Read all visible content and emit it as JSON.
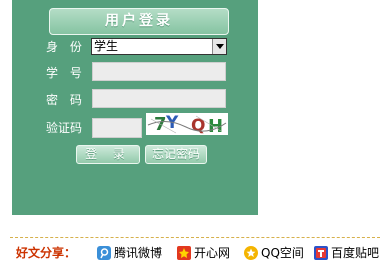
{
  "login": {
    "title": "用户登录",
    "identity_label": "身 份",
    "identity_selected": "学生",
    "student_id_label": "学 号",
    "password_label": "密 码",
    "captcha_label": "验证码",
    "captcha_text": "7Y QH",
    "login_button": "登 录",
    "forgot_button": "忘记密码"
  },
  "share": {
    "label": "好文分享：",
    "items": [
      {
        "label": "腾讯微博",
        "icon": "tencent-weibo-icon"
      },
      {
        "label": "开心网",
        "icon": "kaixin-icon"
      },
      {
        "label": "QQ空间",
        "icon": "qzone-icon"
      },
      {
        "label": "百度贴吧",
        "icon": "baidu-tieba-icon"
      }
    ]
  },
  "colors": {
    "panel": "#56a07d",
    "share_label": "#cc3300",
    "divider": "#d6b04a"
  }
}
